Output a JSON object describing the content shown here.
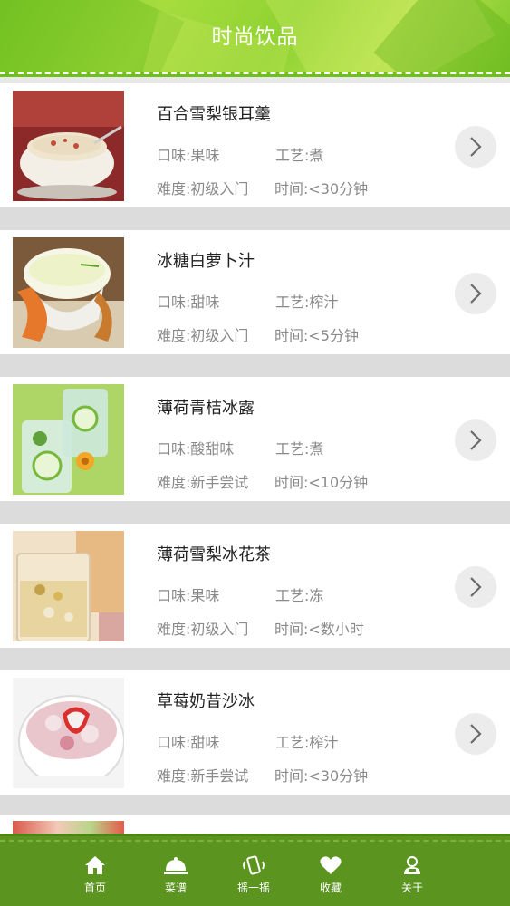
{
  "header": {
    "title": "时尚饮品"
  },
  "items": [
    {
      "title": "百合雪梨银耳羹",
      "taste": "口味:果味",
      "craft": "工艺:煮",
      "difficulty": "难度:初级入门",
      "time": "时间:<30分钟",
      "image": "lily-pear-soup-photo"
    },
    {
      "title": "冰糖白萝卜汁",
      "taste": "口味:甜味",
      "craft": "工艺:榨汁",
      "difficulty": "难度:初级入门",
      "time": "时间:<5分钟",
      "image": "radish-juice-photo"
    },
    {
      "title": "薄荷青桔冰露",
      "taste": "口味:酸甜味",
      "craft": "工艺:煮",
      "difficulty": "难度:新手尝试",
      "time": "时间:<10分钟",
      "image": "mint-lime-drink-photo"
    },
    {
      "title": "薄荷雪梨冰花茶",
      "taste": "口味:果味",
      "craft": "工艺:冻",
      "difficulty": "难度:初级入门",
      "time": "时间:<数小时",
      "image": "mint-pear-tea-photo"
    },
    {
      "title": "草莓奶昔沙冰",
      "taste": "口味:甜味",
      "craft": "工艺:榨汁",
      "difficulty": "难度:新手尝试",
      "time": "时间:<30分钟",
      "image": "strawberry-smoothie-photo"
    }
  ],
  "tabbar": {
    "home": "首页",
    "recipes": "菜谱",
    "shake": "摇一摇",
    "favorites": "收藏",
    "about": "关于"
  },
  "colors": {
    "header_green": "#8fd332",
    "tabbar_green": "#5b9520",
    "meta_gray": "#8a8a8a",
    "arrow_bg": "#ececec"
  }
}
